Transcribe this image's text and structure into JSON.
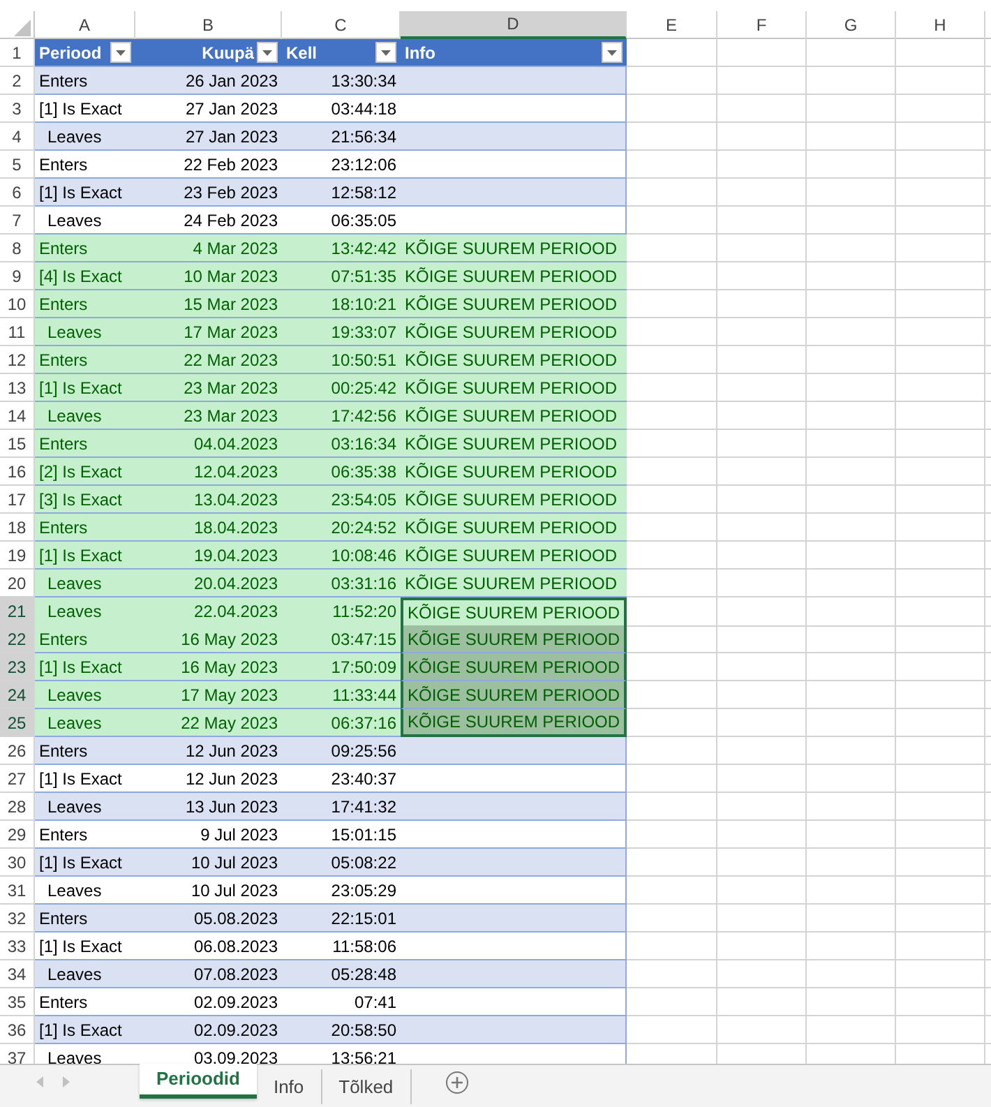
{
  "column_headers": [
    {
      "label": "A",
      "selected": false
    },
    {
      "label": "B",
      "selected": false
    },
    {
      "label": "C",
      "selected": false
    },
    {
      "label": "D",
      "selected": true
    },
    {
      "label": "E",
      "selected": false
    },
    {
      "label": "F",
      "selected": false
    },
    {
      "label": "G",
      "selected": false
    },
    {
      "label": "H",
      "selected": false
    }
  ],
  "table": {
    "row_number": "1",
    "columns": [
      {
        "label": "Periood"
      },
      {
        "label": "Kuupä"
      },
      {
        "label": "Kell"
      },
      {
        "label": "Info"
      }
    ],
    "rows": [
      {
        "n": "2",
        "period": "Enters",
        "indent": false,
        "date": "26 Jan 2023",
        "time": "13:30:34",
        "highlight": false,
        "selected": false
      },
      {
        "n": "3",
        "period": "[1] Is Exact",
        "indent": false,
        "date": "27 Jan 2023",
        "time": "03:44:18",
        "highlight": false,
        "selected": false
      },
      {
        "n": "4",
        "period": "Leaves",
        "indent": true,
        "date": "27 Jan 2023",
        "time": "21:56:34",
        "highlight": false,
        "selected": false
      },
      {
        "n": "5",
        "period": "Enters",
        "indent": false,
        "date": "22 Feb 2023",
        "time": "23:12:06",
        "highlight": false,
        "selected": false
      },
      {
        "n": "6",
        "period": "[1] Is Exact",
        "indent": false,
        "date": "23 Feb 2023",
        "time": "12:58:12",
        "highlight": false,
        "selected": false
      },
      {
        "n": "7",
        "period": "Leaves",
        "indent": true,
        "date": "24 Feb 2023",
        "time": "06:35:05",
        "highlight": false,
        "selected": false
      },
      {
        "n": "8",
        "period": "Enters",
        "indent": false,
        "date": "4 Mar 2023",
        "time": "13:42:42",
        "info": "KÕIGE SUUREM PERIOOD",
        "highlight": true,
        "selected": false
      },
      {
        "n": "9",
        "period": "[4] Is Exact",
        "indent": false,
        "date": "10 Mar 2023",
        "time": "07:51:35",
        "info": "KÕIGE SUUREM PERIOOD",
        "highlight": true,
        "selected": false
      },
      {
        "n": "10",
        "period": "Enters",
        "indent": false,
        "date": "15 Mar 2023",
        "time": "18:10:21",
        "info": "KÕIGE SUUREM PERIOOD",
        "highlight": true,
        "selected": false
      },
      {
        "n": "11",
        "period": "Leaves",
        "indent": true,
        "date": "17 Mar 2023",
        "time": "19:33:07",
        "info": "KÕIGE SUUREM PERIOOD",
        "highlight": true,
        "selected": false
      },
      {
        "n": "12",
        "period": "Enters",
        "indent": false,
        "date": "22 Mar 2023",
        "time": "10:50:51",
        "info": "KÕIGE SUUREM PERIOOD",
        "highlight": true,
        "selected": false
      },
      {
        "n": "13",
        "period": "[1] Is Exact",
        "indent": false,
        "date": "23 Mar 2023",
        "time": "00:25:42",
        "info": "KÕIGE SUUREM PERIOOD",
        "highlight": true,
        "selected": false
      },
      {
        "n": "14",
        "period": "Leaves",
        "indent": true,
        "date": "23 Mar 2023",
        "time": "17:42:56",
        "info": "KÕIGE SUUREM PERIOOD",
        "highlight": true,
        "selected": false
      },
      {
        "n": "15",
        "period": "Enters",
        "indent": false,
        "date": "04.04.2023",
        "time": "03:16:34",
        "info": "KÕIGE SUUREM PERIOOD",
        "highlight": true,
        "selected": false
      },
      {
        "n": "16",
        "period": "[2] Is Exact",
        "indent": false,
        "date": "12.04.2023",
        "time": "06:35:38",
        "info": "KÕIGE SUUREM PERIOOD",
        "highlight": true,
        "selected": false
      },
      {
        "n": "17",
        "period": "[3] Is Exact",
        "indent": false,
        "date": "13.04.2023",
        "time": "23:54:05",
        "info": "KÕIGE SUUREM PERIOOD",
        "highlight": true,
        "selected": false
      },
      {
        "n": "18",
        "period": "Enters",
        "indent": false,
        "date": "18.04.2023",
        "time": "20:24:52",
        "info": "KÕIGE SUUREM PERIOOD",
        "highlight": true,
        "selected": false
      },
      {
        "n": "19",
        "period": "[1] Is Exact",
        "indent": false,
        "date": "19.04.2023",
        "time": "10:08:46",
        "info": "KÕIGE SUUREM PERIOOD",
        "highlight": true,
        "selected": false
      },
      {
        "n": "20",
        "period": "Leaves",
        "indent": true,
        "date": "20.04.2023",
        "time": "03:31:16",
        "info": "KÕIGE SUUREM PERIOOD",
        "highlight": true,
        "selected": false
      },
      {
        "n": "21",
        "period": "Leaves",
        "indent": true,
        "date": "22.04.2023",
        "time": "11:52:20",
        "info": "KÕIGE SUUREM PERIOOD",
        "highlight": true,
        "selected": true,
        "active": true
      },
      {
        "n": "22",
        "period": "Enters",
        "indent": false,
        "date": "16 May 2023",
        "time": "03:47:15",
        "info": "KÕIGE SUUREM PERIOOD",
        "highlight": true,
        "selected": true,
        "active": false
      },
      {
        "n": "23",
        "period": "[1] Is Exact",
        "indent": false,
        "date": "16 May 2023",
        "time": "17:50:09",
        "info": "KÕIGE SUUREM PERIOOD",
        "highlight": true,
        "selected": true,
        "active": false
      },
      {
        "n": "24",
        "period": "Leaves",
        "indent": true,
        "date": "17 May 2023",
        "time": "11:33:44",
        "info": "KÕIGE SUUREM PERIOOD",
        "highlight": true,
        "selected": true,
        "active": false
      },
      {
        "n": "25",
        "period": "Leaves",
        "indent": true,
        "date": "22 May 2023",
        "time": "06:37:16",
        "info": "KÕIGE SUUREM PERIOOD",
        "highlight": true,
        "selected": true,
        "active": false
      },
      {
        "n": "26",
        "period": "Enters",
        "indent": false,
        "date": "12 Jun 2023",
        "time": "09:25:56",
        "highlight": false,
        "selected": false
      },
      {
        "n": "27",
        "period": "[1] Is Exact",
        "indent": false,
        "date": "12 Jun 2023",
        "time": "23:40:37",
        "highlight": false,
        "selected": false
      },
      {
        "n": "28",
        "period": "Leaves",
        "indent": true,
        "date": "13 Jun 2023",
        "time": "17:41:32",
        "highlight": false,
        "selected": false
      },
      {
        "n": "29",
        "period": "Enters",
        "indent": false,
        "date": "9 Jul 2023",
        "time": "15:01:15",
        "highlight": false,
        "selected": false
      },
      {
        "n": "30",
        "period": "[1] Is Exact",
        "indent": false,
        "date": "10 Jul 2023",
        "time": "05:08:22",
        "highlight": false,
        "selected": false
      },
      {
        "n": "31",
        "period": "Leaves",
        "indent": true,
        "date": "10 Jul 2023",
        "time": "23:05:29",
        "highlight": false,
        "selected": false
      },
      {
        "n": "32",
        "period": "Enters",
        "indent": false,
        "date": "05.08.2023",
        "time": "22:15:01",
        "highlight": false,
        "selected": false
      },
      {
        "n": "33",
        "period": "[1] Is Exact",
        "indent": false,
        "date": "06.08.2023",
        "time": "11:58:06",
        "highlight": false,
        "selected": false
      },
      {
        "n": "34",
        "period": "Leaves",
        "indent": true,
        "date": "07.08.2023",
        "time": "05:28:48",
        "highlight": false,
        "selected": false
      },
      {
        "n": "35",
        "period": "Enters",
        "indent": false,
        "date": "02.09.2023",
        "time": "07:41",
        "highlight": false,
        "selected": false
      },
      {
        "n": "36",
        "period": "[1] Is Exact",
        "indent": false,
        "date": "02.09.2023",
        "time": "20:58:50",
        "highlight": false,
        "selected": false
      },
      {
        "n": "37",
        "period": "Leaves",
        "indent": true,
        "date": "03.09.2023",
        "time": "13:56:21",
        "highlight": false,
        "selected": false
      }
    ]
  },
  "sheet_tabs": [
    {
      "label": "Perioodid",
      "selected": true
    },
    {
      "label": "Info",
      "selected": false
    },
    {
      "label": "Tõlked",
      "selected": false
    }
  ]
}
